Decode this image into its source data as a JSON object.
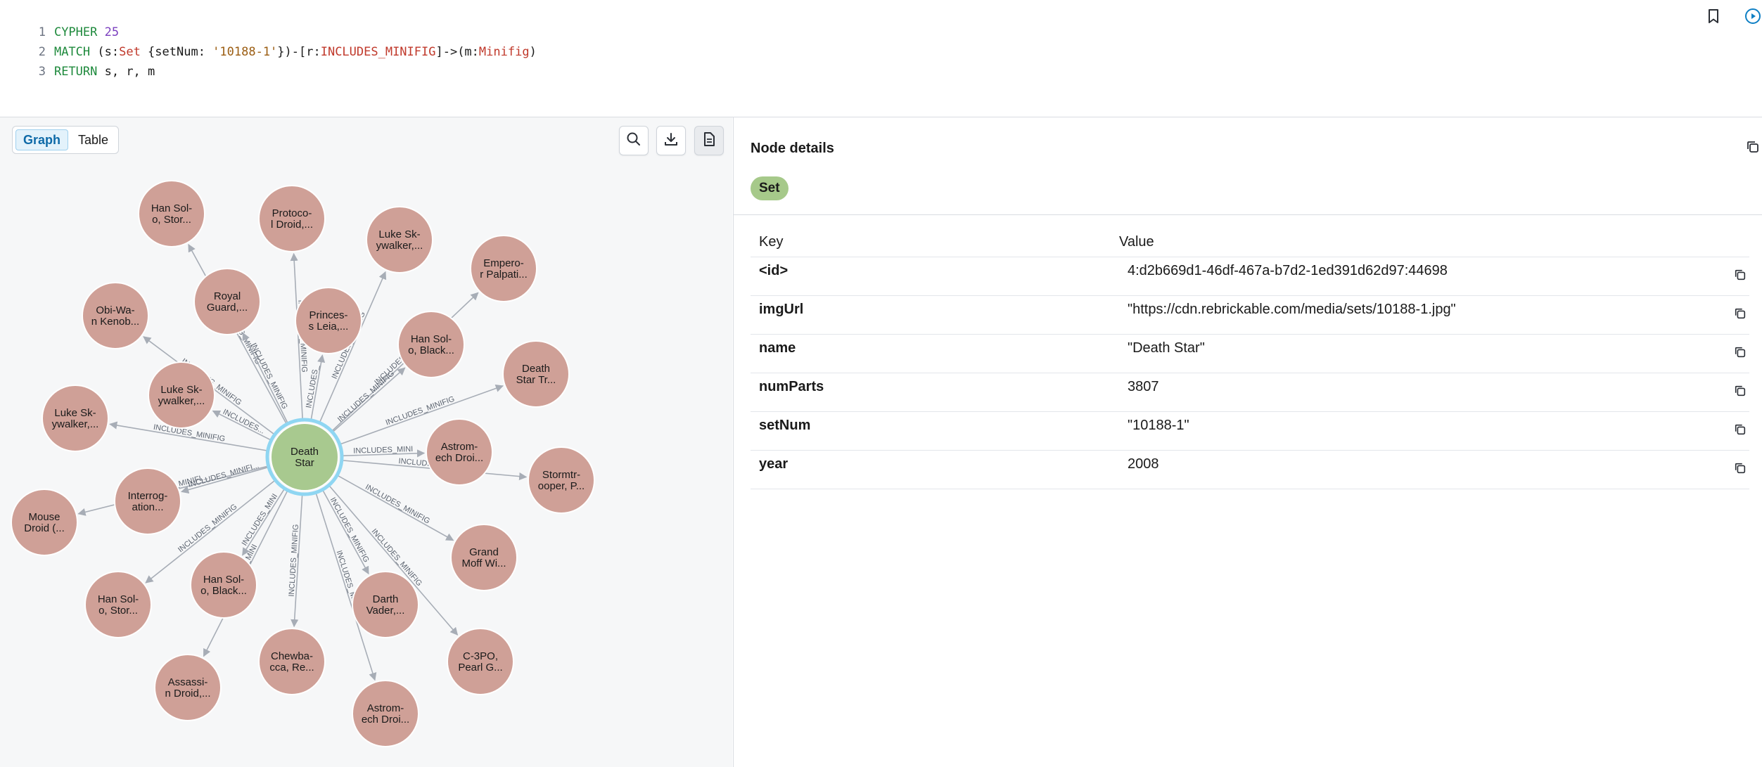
{
  "editor": {
    "line_numbers": [
      "1",
      "2",
      "3"
    ],
    "line1": {
      "kw": "CYPHER",
      "num": "25"
    },
    "line2": {
      "t1": "MATCH (s:",
      "t2": "Set",
      "t3": " {setNum: ",
      "t4": "'10188-1'",
      "t5": "})-[r:",
      "t6": "INCLUDES_MINIFIG",
      "t7": "]->(m:",
      "t8": "Minifig",
      "t9": ")"
    },
    "line3": {
      "kw": "RETURN",
      "rest": " s, r, m"
    },
    "icons": {
      "bookmark": "bookmark-icon",
      "run": "run-icon"
    }
  },
  "graph_panel": {
    "tabs": [
      {
        "label": "Graph",
        "active": true
      },
      {
        "label": "Table",
        "active": false
      }
    ],
    "toolbar": [
      "search-icon",
      "download-icon",
      "document-icon"
    ],
    "colors": {
      "center_node": "#a8c98f",
      "center_ring": "#8fd6f2",
      "minifig_node": "#cfa097",
      "edge": "#a7adb6"
    },
    "center_node": {
      "label_lines": [
        "Death",
        "Star"
      ]
    },
    "nodes": [
      {
        "label_lines": [
          "Han Sol-",
          "o, Stor..."
        ]
      },
      {
        "label_lines": [
          "Protoco-",
          "l Droid,..."
        ]
      },
      {
        "label_lines": [
          "Luke Sk-",
          "ywalker,..."
        ]
      },
      {
        "label_lines": [
          "Empero-",
          "r Palpati..."
        ]
      },
      {
        "label_lines": [
          "Death",
          "Star Tr..."
        ]
      },
      {
        "label_lines": [
          "Stormtr-",
          "ooper, P..."
        ]
      },
      {
        "label_lines": [
          "Grand",
          "Moff Wi..."
        ]
      },
      {
        "label_lines": [
          "C-3PO,",
          "Pearl G..."
        ]
      },
      {
        "label_lines": [
          "Astrom-",
          "ech Droi..."
        ]
      },
      {
        "label_lines": [
          "Chewba-",
          "cca, Re..."
        ]
      },
      {
        "label_lines": [
          "Assassi-",
          "n Droid,..."
        ]
      },
      {
        "label_lines": [
          "Han Sol-",
          "o, Stor..."
        ]
      },
      {
        "label_lines": [
          "Mouse",
          "Droid (..."
        ]
      },
      {
        "label_lines": [
          "Luke Sk-",
          "ywalker,..."
        ]
      },
      {
        "label_lines": [
          "Obi-Wa-",
          "n Kenob..."
        ]
      },
      {
        "label_lines": [
          "Royal",
          "Guard,..."
        ]
      },
      {
        "label_lines": [
          "Princes-",
          "s Leia,..."
        ]
      },
      {
        "label_lines": [
          "Han Sol-",
          "o, Black..."
        ]
      },
      {
        "label_lines": [
          "Astrom-",
          "ech Droi..."
        ]
      },
      {
        "label_lines": [
          "Darth",
          "Vader,..."
        ]
      },
      {
        "label_lines": [
          "Han Sol-",
          "o, Black..."
        ]
      },
      {
        "label_lines": [
          "Interrog-",
          "ation..."
        ]
      },
      {
        "label_lines": [
          "Luke Sk-",
          "ywalker,..."
        ]
      }
    ],
    "edge_labels": [
      "INCLUDES_MINIFIG",
      "INCLUDES_MINIFIG",
      "INCLUDES_MINIFIG",
      "INCLUDES_MINIFIG",
      "INCLUDES_MINIFIG",
      "INCLUDES_MINIFIG",
      "INCLUDES_MINIFIG",
      "INCLUDES_MINIFIG",
      "INCLUDES_MINIFIG",
      "INCLUDES_MINIFIG",
      "INCLUDES_MINI",
      "INCLUDES_MINIFIG",
      "INCLUDES_MINIFI...",
      "INCLUDES_MINIFIG",
      "INCLUDES_MINIFIG",
      "INCLUDES_MINIFIG",
      "INCLUDES_",
      "INCLUDES_MINIFIG",
      "INCLUDES_MINI",
      "INCLUDES_MINIFIG",
      "INCLUDES_MINI",
      "INCLUDES_MINIFI...",
      "INCLUDES..."
    ]
  },
  "details": {
    "title": "Node details",
    "label_badge": "Set",
    "badge_color": "#a6c98a",
    "headers": {
      "key": "Key",
      "value": "Value"
    },
    "properties": [
      {
        "key": "<id>",
        "value": "4:d2b669d1-46df-467a-b7d2-1ed391d62d97:44698"
      },
      {
        "key": "imgUrl",
        "value": "\"https://cdn.rebrickable.com/media/sets/10188-1.jpg\""
      },
      {
        "key": "name",
        "value": "\"Death Star\""
      },
      {
        "key": "numParts",
        "value": "3807"
      },
      {
        "key": "setNum",
        "value": "\"10188-1\""
      },
      {
        "key": "year",
        "value": "2008"
      }
    ]
  }
}
